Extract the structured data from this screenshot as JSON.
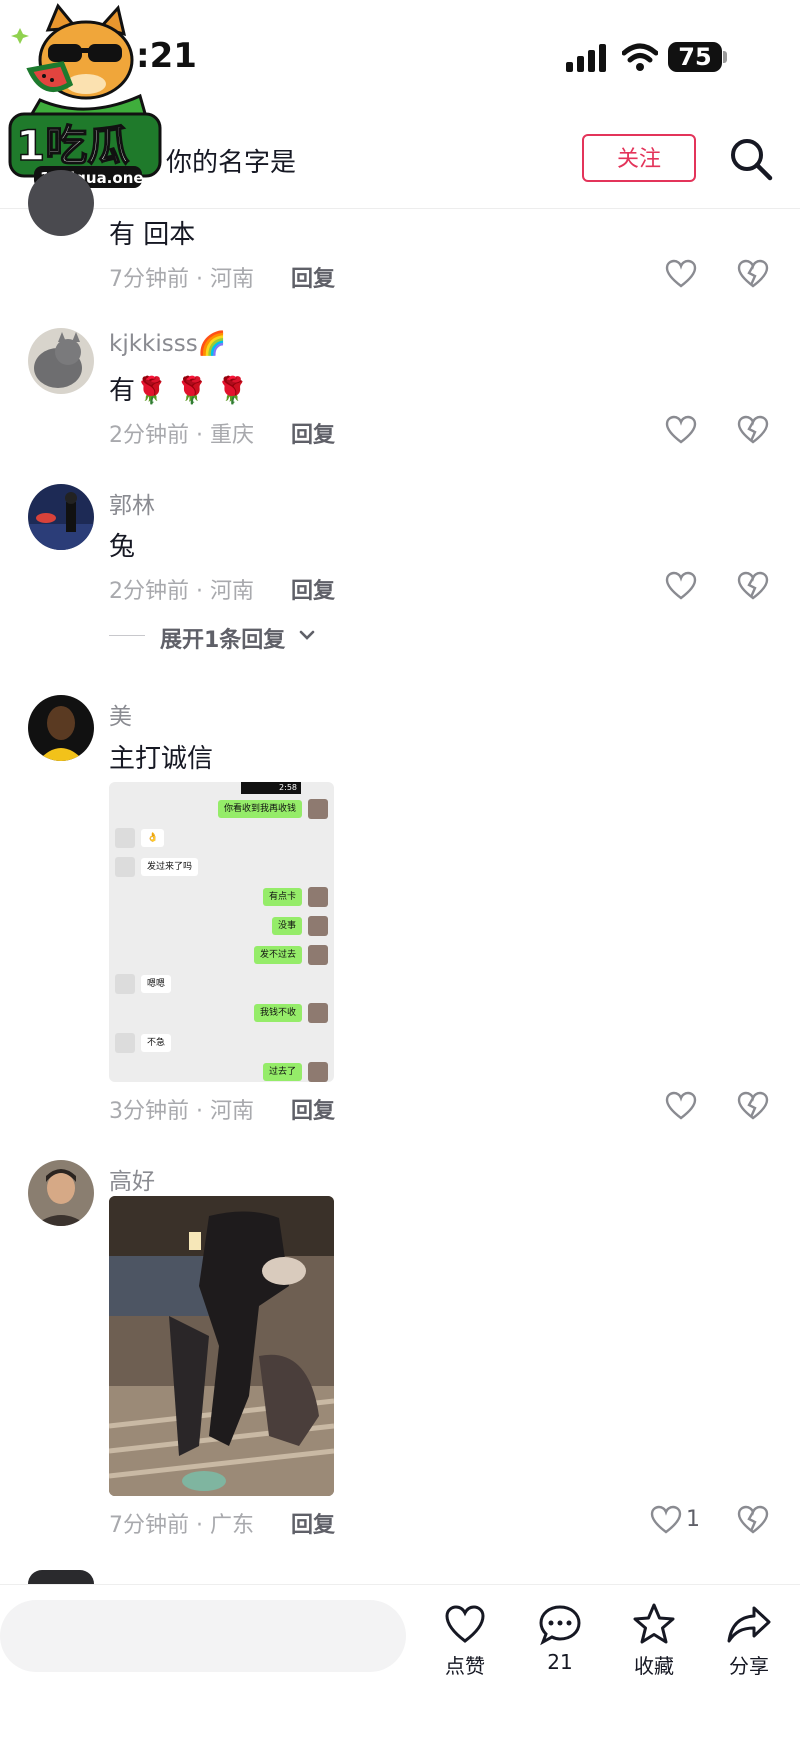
{
  "status": {
    "time": ":21",
    "battery": "75"
  },
  "logo": {
    "text": "1吃瓜",
    "domain": "1chigua.one"
  },
  "header": {
    "title": "你的名字是",
    "follow": "关注"
  },
  "comments": [
    {
      "text": "有 回本",
      "meta": "7分钟前 · 河南",
      "reply": "回复"
    },
    {
      "user": "kjkkisss🌈",
      "text": "有🌹 🌹 🌹",
      "meta": "2分钟前 · 重庆",
      "reply": "回复"
    },
    {
      "user": "郭林",
      "text": "兔",
      "meta": "2分钟前 · 河南",
      "reply": "回复",
      "expand": "展开1条回复"
    },
    {
      "user": "美",
      "text": "主打诚信",
      "meta": "3分钟前 · 河南",
      "reply": "回复"
    },
    {
      "user": "高好",
      "meta": "7分钟前 · 广东",
      "reply": "回复",
      "likes": "1"
    }
  ],
  "chat_screenshot": {
    "time": "2:58",
    "messages": [
      {
        "side": "right",
        "text": "你看收到我再收钱"
      },
      {
        "side": "left",
        "text": "👌"
      },
      {
        "side": "left",
        "text": "发过来了吗"
      },
      {
        "side": "right",
        "text": "有点卡"
      },
      {
        "side": "right",
        "text": "没事"
      },
      {
        "side": "right",
        "text": "发不过去"
      },
      {
        "side": "left",
        "text": "嗯嗯"
      },
      {
        "side": "right",
        "text": "我钱不收"
      },
      {
        "side": "left",
        "text": "不急"
      },
      {
        "side": "right",
        "text": "过去了"
      }
    ]
  },
  "bottom": {
    "like": "点赞",
    "comments": "21",
    "favorite": "收藏",
    "share": "分享"
  },
  "colors": {
    "accent": "#e3345a",
    "chat_green": "#95ec69"
  }
}
